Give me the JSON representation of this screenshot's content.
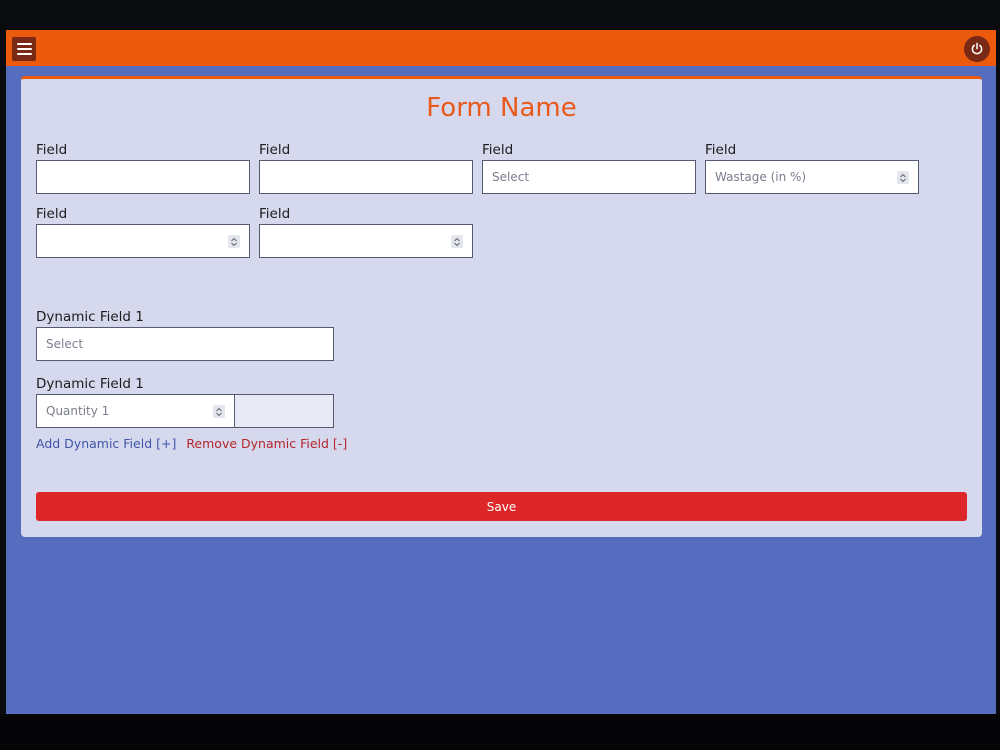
{
  "header": {
    "menu_icon": "hamburger-icon",
    "power_icon": "power-icon",
    "accent_color": "#ec5a0d"
  },
  "form": {
    "title": "Form Name",
    "fields": [
      {
        "label": "Field",
        "placeholder": "",
        "type": "text"
      },
      {
        "label": "Field",
        "placeholder": "",
        "type": "text"
      },
      {
        "label": "Field",
        "placeholder": "Select",
        "type": "select"
      },
      {
        "label": "Field",
        "placeholder": "Wastage (in %)",
        "type": "number"
      },
      {
        "label": "Field",
        "placeholder": "",
        "type": "number"
      },
      {
        "label": "Field",
        "placeholder": "",
        "type": "number"
      }
    ],
    "dynamic_select": {
      "label": "Dynamic Field 1",
      "placeholder": "Select"
    },
    "dynamic_quantity": {
      "label": "Dynamic Field 1",
      "placeholder": "Quantity 1"
    },
    "add_link": "Add Dynamic Field [+]",
    "remove_link": "Remove Dynamic Field [-]",
    "save_label": "Save",
    "save_color": "#dc2627"
  }
}
